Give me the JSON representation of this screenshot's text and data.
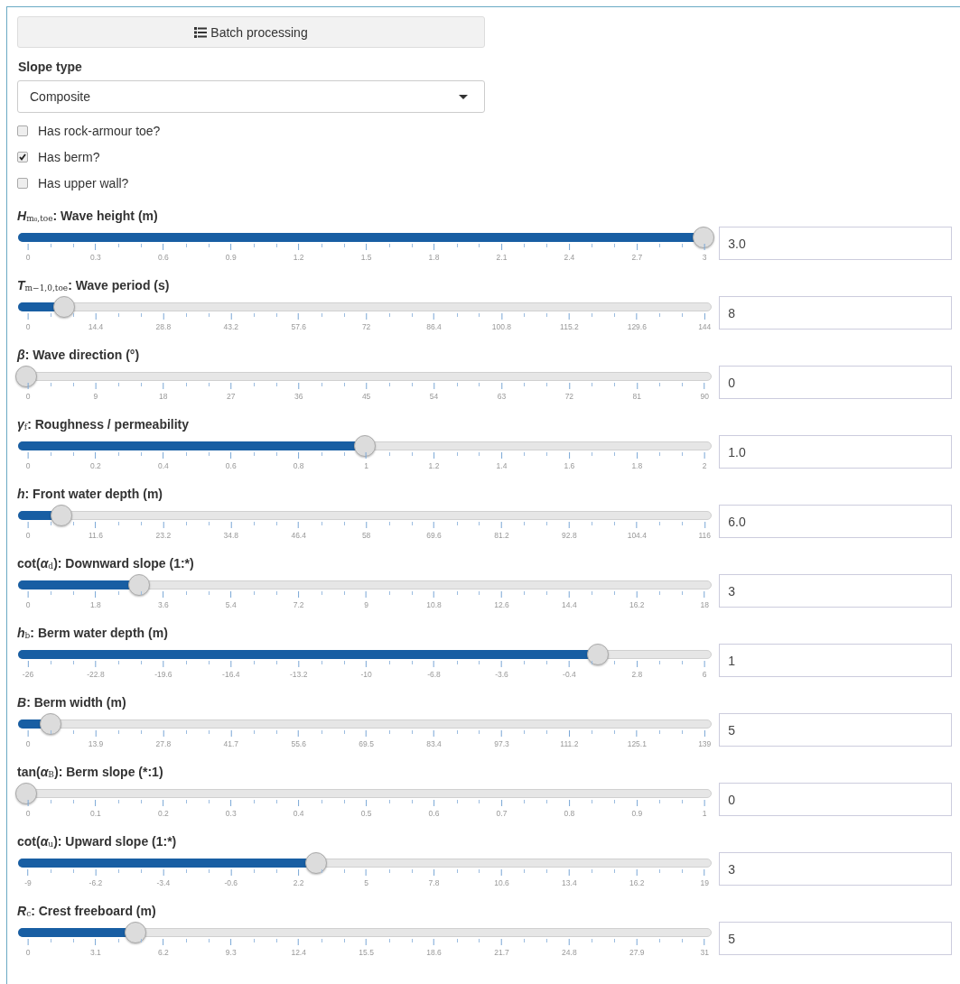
{
  "batch_button": {
    "label": "Batch processing"
  },
  "slope_type": {
    "label": "Slope type",
    "value": "Composite"
  },
  "checkboxes": [
    {
      "label": "Has rock-armour toe?",
      "checked": false
    },
    {
      "label": "Has berm?",
      "checked": true
    },
    {
      "label": "Has upper wall?",
      "checked": false
    }
  ],
  "sliders": [
    {
      "label": "*H*$_{m₀,toe}$: Wave height (m)",
      "level": 1.0,
      "value": "3.0",
      "ticks": [
        "0",
        "0.3",
        "0.6",
        "0.9",
        "1.2",
        "1.5",
        "1.8",
        "2.1",
        "2.4",
        "2.7",
        "3"
      ]
    },
    {
      "label": "*T*$_{m−1,0,toe}$: Wave period (s)",
      "level": 0.0556,
      "value": "8",
      "ticks": [
        "0",
        "14.4",
        "28.8",
        "43.2",
        "57.6",
        "72",
        "86.4",
        "100.8",
        "115.2",
        "129.6",
        "144"
      ]
    },
    {
      "label": "*β*: Wave direction (°)",
      "level": 0,
      "value": "0",
      "ticks": [
        "0",
        "9",
        "18",
        "27",
        "36",
        "45",
        "54",
        "63",
        "72",
        "81",
        "90"
      ]
    },
    {
      "label": "*γ*$_{f}$: Roughness / permeability",
      "level": 0.5,
      "value": "1.0",
      "ticks": [
        "0",
        "0.2",
        "0.4",
        "0.6",
        "0.8",
        "1",
        "1.2",
        "1.4",
        "1.6",
        "1.8",
        "2"
      ]
    },
    {
      "label": "*h*: Front water depth (m)",
      "level": 0.0517,
      "value": "6.0",
      "ticks": [
        "0",
        "11.6",
        "23.2",
        "34.8",
        "46.4",
        "58",
        "69.6",
        "81.2",
        "92.8",
        "104.4",
        "116"
      ]
    },
    {
      "label": "cot(*α*$_{d}$): Downward slope (1:*)",
      "level": 0.1667,
      "value": "3",
      "ticks": [
        "0",
        "1.8",
        "3.6",
        "5.4",
        "7.2",
        "9",
        "10.8",
        "12.6",
        "14.4",
        "16.2",
        "18"
      ]
    },
    {
      "label": "*h*$_{b}$: Berm water depth (m)",
      "level": 0.8438,
      "value": "1",
      "ticks": [
        "-26",
        "-22.8",
        "-19.6",
        "-16.4",
        "-13.2",
        "-10",
        "-6.8",
        "-3.6",
        "-0.4",
        "2.8",
        "6"
      ]
    },
    {
      "label": "*B*: Berm width (m)",
      "level": 0.036,
      "value": "5",
      "ticks": [
        "0",
        "13.9",
        "27.8",
        "41.7",
        "55.6",
        "69.5",
        "83.4",
        "97.3",
        "111.2",
        "125.1",
        "139"
      ]
    },
    {
      "label": "tan(*α*$_{B}$): Berm slope (*:1)",
      "level": 0,
      "value": "0",
      "ticks": [
        "0",
        "0.1",
        "0.2",
        "0.3",
        "0.4",
        "0.5",
        "0.6",
        "0.7",
        "0.8",
        "0.9",
        "1"
      ]
    },
    {
      "label": "cot(*α*$_{u}$): Upward slope (1:*)",
      "level": 0.4286,
      "value": "3",
      "ticks": [
        "-9",
        "-6.2",
        "-3.4",
        "-0.6",
        "2.2",
        "5",
        "7.8",
        "10.6",
        "13.4",
        "16.2",
        "19"
      ]
    },
    {
      "label": "*R*$_{c}$: Crest freeboard (m)",
      "level": 0.1613,
      "value": "5",
      "ticks": [
        "0",
        "3.1",
        "6.2",
        "9.3",
        "12.4",
        "15.5",
        "18.6",
        "21.7",
        "24.8",
        "27.9",
        "31"
      ]
    }
  ]
}
